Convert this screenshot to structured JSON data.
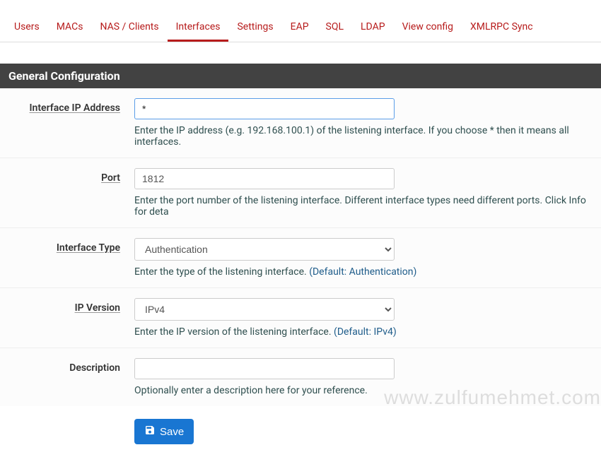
{
  "tabs": [
    {
      "label": "Users",
      "active": false
    },
    {
      "label": "MACs",
      "active": false
    },
    {
      "label": "NAS / Clients",
      "active": false
    },
    {
      "label": "Interfaces",
      "active": true
    },
    {
      "label": "Settings",
      "active": false
    },
    {
      "label": "EAP",
      "active": false
    },
    {
      "label": "SQL",
      "active": false
    },
    {
      "label": "LDAP",
      "active": false
    },
    {
      "label": "View config",
      "active": false
    },
    {
      "label": "XMLRPC Sync",
      "active": false
    }
  ],
  "section_title": "General Configuration",
  "fields": {
    "ip": {
      "label": "Interface IP Address",
      "value": "*",
      "help": "Enter the IP address (e.g. 192.168.100.1) of the listening interface. If you choose * then it means all interfaces."
    },
    "port": {
      "label": "Port",
      "value": "1812",
      "help": "Enter the port number of the listening interface. Different interface types need different ports. Click Info for deta"
    },
    "type": {
      "label": "Interface Type",
      "value": "Authentication",
      "help_prefix": "Enter the type of the listening interface. ",
      "default_text": "(Default: Authentication)"
    },
    "ipver": {
      "label": "IP Version",
      "value": "IPv4",
      "help_prefix": "Enter the IP version of the listening interface. ",
      "default_text": "(Default: IPv4)"
    },
    "desc": {
      "label": "Description",
      "value": "",
      "help": "Optionally enter a description here for your reference."
    }
  },
  "save_label": "Save",
  "watermark": "www.zulfumehmet.com"
}
